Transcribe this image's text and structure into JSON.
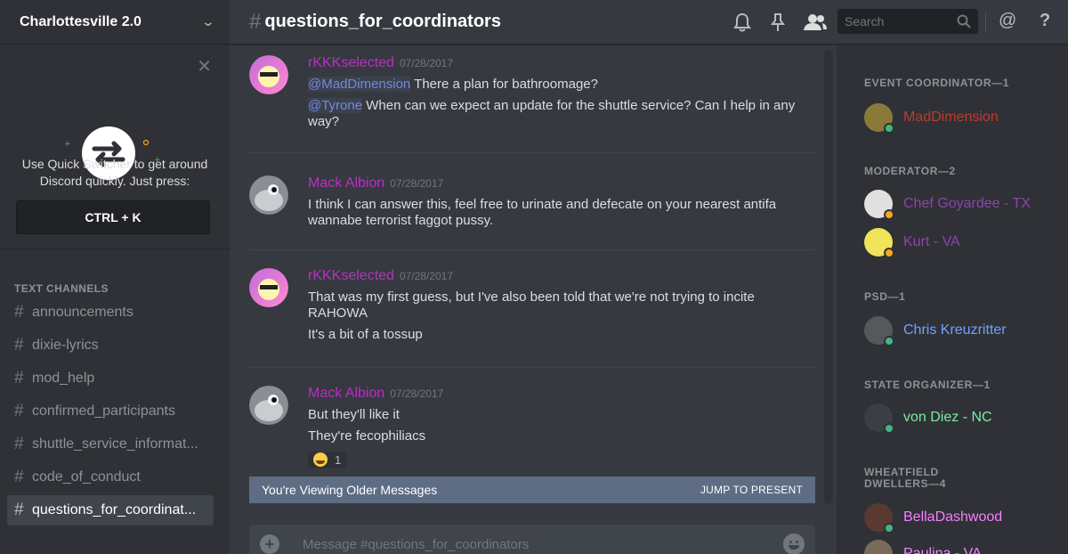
{
  "sidebar": {
    "guild_name": "Charlottesville 2.0",
    "quick_switcher": {
      "text": "Use Quick Switcher to get around Discord quickly. Just press:",
      "shortcut": "CTRL + K"
    },
    "category": "TEXT CHANNELS",
    "channels": [
      {
        "name": "announcements"
      },
      {
        "name": "dixie-lyrics"
      },
      {
        "name": "mod_help"
      },
      {
        "name": "confirmed_participants"
      },
      {
        "name": "shuttle_service_informat..."
      },
      {
        "name": "code_of_conduct"
      },
      {
        "name": "questions_for_coordinat...",
        "active": true
      }
    ]
  },
  "header": {
    "channel": "questions_for_coordinators",
    "search_placeholder": "Search"
  },
  "messages": [
    {
      "author": "rKKKselected",
      "timestamp": "07/28/2017",
      "lines": [
        {
          "mention": "@MadDimension",
          "text": " There a plan for bathroomage?"
        },
        {
          "mention": "@Tyrone",
          "text": " When can we expect an update for the shuttle service? Can I help in any way?"
        }
      ]
    },
    {
      "author": "Mack Albion",
      "timestamp": "07/28/2017",
      "lines": [
        {
          "text": "I think I can answer this, feel free to urinate and defecate on your nearest antifa wannabe terrorist faggot pussy."
        }
      ]
    },
    {
      "author": "rKKKselected",
      "timestamp": "07/28/2017",
      "lines": [
        {
          "text": "That was my first guess, but I've also been told that we're not trying to incite RAHOWA"
        },
        {
          "text": "It's a bit of a tossup"
        }
      ]
    },
    {
      "author": "Mack Albion",
      "timestamp": "07/28/2017",
      "lines": [
        {
          "text": "But they'll like it"
        },
        {
          "text": "They're fecophiliacs"
        }
      ],
      "reaction": {
        "emoji": "joy-emoji",
        "count": "1"
      }
    }
  ],
  "older_bar": {
    "text": "You're Viewing Older Messages",
    "jump": "JUMP TO PRESENT"
  },
  "composer": {
    "placeholder": "Message #questions_for_coordinators"
  },
  "members": {
    "groups": [
      {
        "title": "EVENT COORDINATOR—1",
        "members": [
          {
            "name": "MadDimension",
            "color": "#c0392b",
            "status": "online"
          }
        ]
      },
      {
        "title": "MODERATOR—2",
        "members": [
          {
            "name": "Chef Goyardee - TX",
            "color": "#8e44ad",
            "status": "idle"
          },
          {
            "name": "Kurt - VA",
            "color": "#8e44ad",
            "status": "idle"
          }
        ]
      },
      {
        "title": "PSD—1",
        "members": [
          {
            "name": "Chris Kreuzritter",
            "color": "#6fa3ff",
            "status": "online"
          }
        ]
      },
      {
        "title": "STATE ORGANIZER—1",
        "members": [
          {
            "name": "von Diez - NC",
            "color": "#7bed9f",
            "status": "online"
          }
        ]
      },
      {
        "title": "WHEATFIELD DWELLERS—4",
        "members": [
          {
            "name": "BellaDashwood",
            "color": "#f47fff",
            "status": "online"
          },
          {
            "name": "Paulina - VA",
            "color": "#f47fff",
            "status": "online"
          }
        ]
      }
    ]
  },
  "colors": {
    "username": "#b730c4",
    "mention": "#7289da",
    "online": "#43b581",
    "idle": "#faa61a"
  }
}
